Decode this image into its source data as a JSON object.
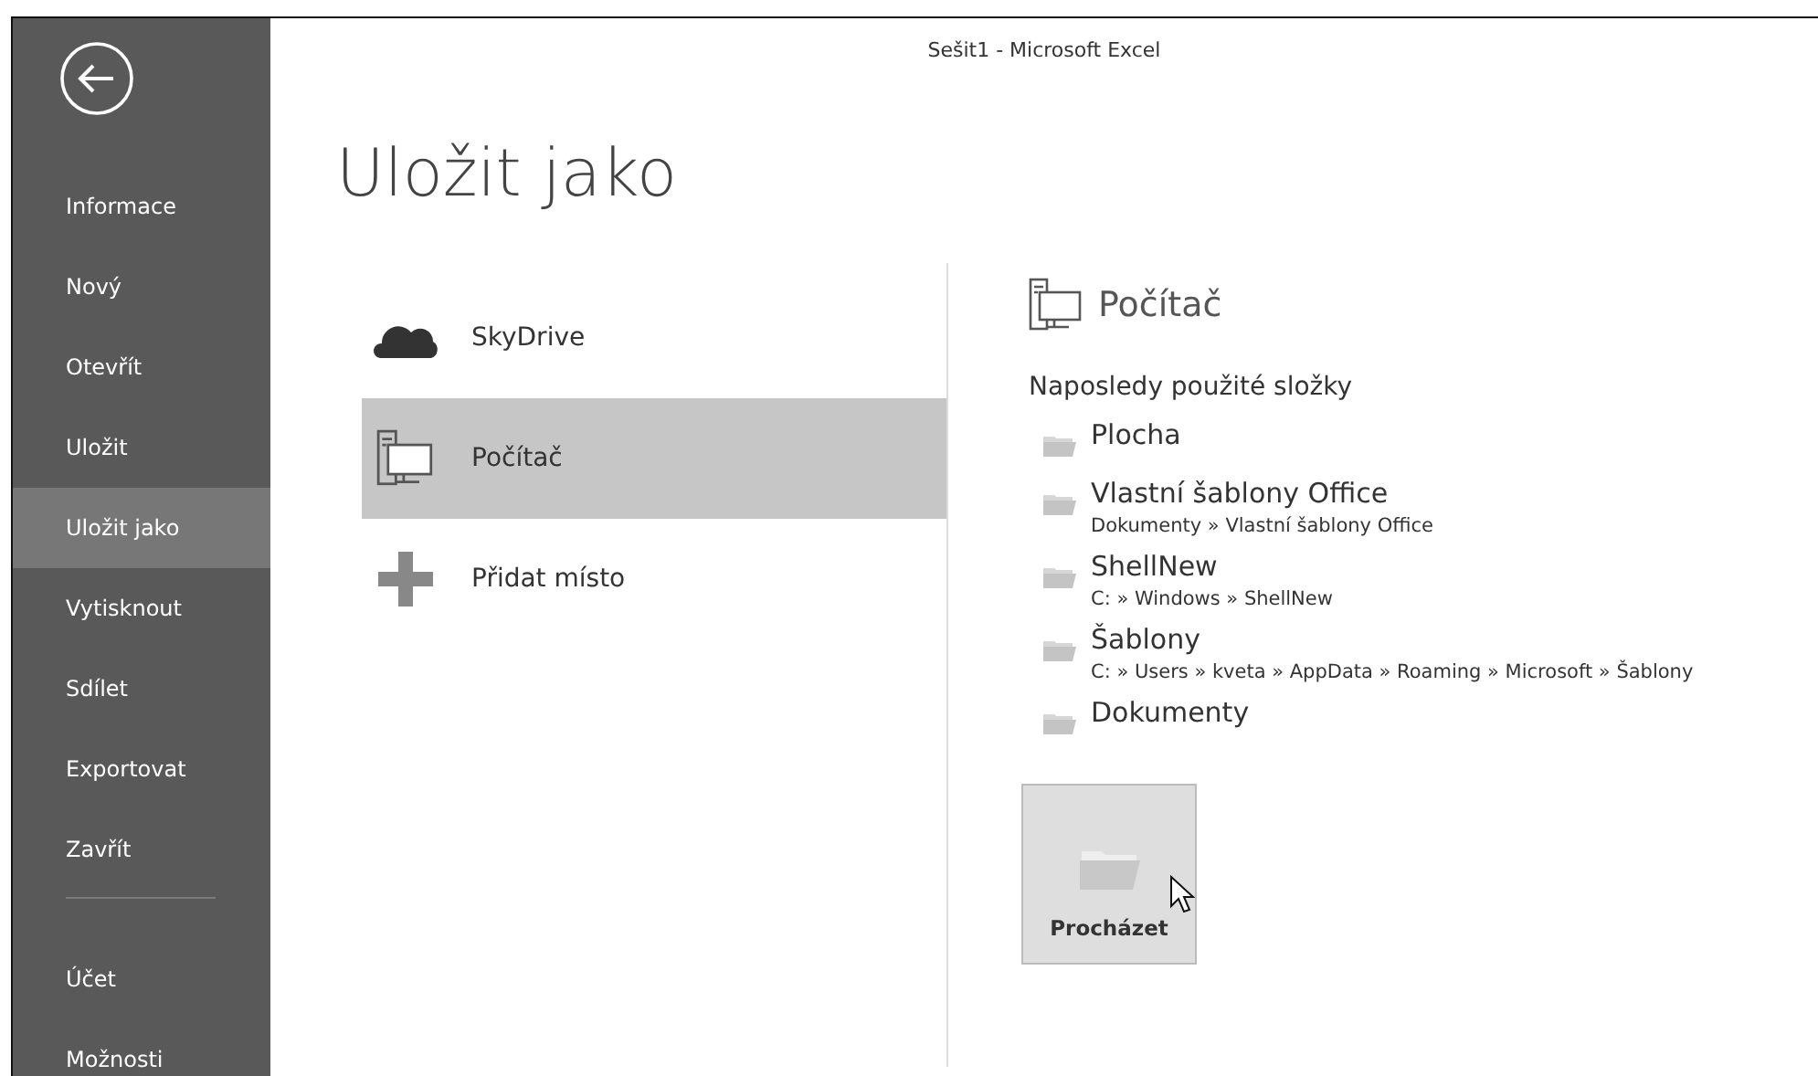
{
  "window": {
    "title": "Sešit1 - Microsoft Excel"
  },
  "sidebar": {
    "items": [
      {
        "label": "Informace",
        "selected": false
      },
      {
        "label": "Nový",
        "selected": false
      },
      {
        "label": "Otevřít",
        "selected": false
      },
      {
        "label": "Uložit",
        "selected": false
      },
      {
        "label": "Uložit jako",
        "selected": true
      },
      {
        "label": "Vytisknout",
        "selected": false
      },
      {
        "label": "Sdílet",
        "selected": false
      },
      {
        "label": "Exportovat",
        "selected": false
      },
      {
        "label": "Zavřít",
        "selected": false
      }
    ],
    "bottom_items": [
      {
        "label": "Účet",
        "selected": false
      },
      {
        "label": "Možnosti",
        "selected": false
      }
    ]
  },
  "page_title": "Uložit jako",
  "places": [
    {
      "kind": "cloud",
      "label": "SkyDrive",
      "selected": false
    },
    {
      "kind": "computer",
      "label": "Počítač",
      "selected": true
    },
    {
      "kind": "add",
      "label": "Přidat místo",
      "selected": false
    }
  ],
  "detail": {
    "title": "Počítač",
    "section": "Naposledy použité složky",
    "folders": [
      {
        "name": "Plocha"
      },
      {
        "name": "Vlastní šablony Office",
        "path": "Dokumenty » Vlastní šablony Office"
      },
      {
        "name": "ShellNew",
        "path": "C: » Windows » ShellNew"
      },
      {
        "name": "Šablony",
        "path": "C: » Users » kveta » AppData » Roaming » Microsoft » Šablony"
      },
      {
        "name": "Dokumenty"
      }
    ],
    "browse_button": "Procházet"
  }
}
